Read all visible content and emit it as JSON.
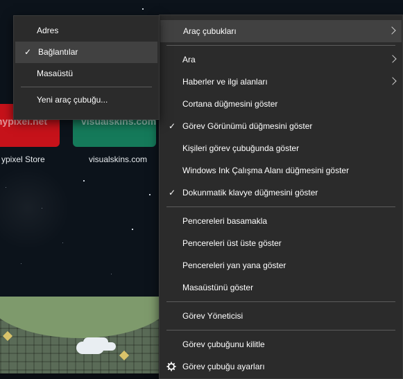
{
  "background": {
    "tiles": [
      {
        "name": "hypixel",
        "tile_text": "e.hypixel.net",
        "caption": "ypixel Store",
        "color": "#c6121a"
      },
      {
        "name": "visualskins",
        "tile_text": "visualskins.com",
        "caption": "visualskins.com",
        "color": "#157a5a"
      }
    ]
  },
  "submenu": {
    "items": [
      {
        "label": "Adres",
        "checked": false,
        "highlighted": false
      },
      {
        "label": "Bağlantılar",
        "checked": true,
        "highlighted": true
      },
      {
        "label": "Masaüstü",
        "checked": false,
        "highlighted": false
      },
      {
        "label": "Yeni araç çubuğu...",
        "checked": false,
        "highlighted": false
      }
    ]
  },
  "main_menu": {
    "groups": [
      [
        {
          "label": "Araç çubukları",
          "submenu": true,
          "highlighted": true
        }
      ],
      [
        {
          "label": "Ara",
          "submenu": true
        },
        {
          "label": "Haberler ve ilgi alanları",
          "submenu": true
        },
        {
          "label": "Cortana düğmesini göster"
        },
        {
          "label": "Görev Görünümü düğmesini göster",
          "checked": true
        },
        {
          "label": "Kişileri görev çubuğunda göster"
        },
        {
          "label": "Windows Ink Çalışma Alanı düğmesini göster"
        },
        {
          "label": "Dokunmatik klavye düğmesini göster",
          "checked": true
        }
      ],
      [
        {
          "label": "Pencereleri basamakla"
        },
        {
          "label": "Pencereleri üst üste göster"
        },
        {
          "label": "Pencereleri yan yana göster"
        },
        {
          "label": "Masaüstünü göster"
        }
      ],
      [
        {
          "label": "Görev Yöneticisi"
        }
      ],
      [
        {
          "label": "Görev çubuğunu kilitle"
        },
        {
          "label": "Görev çubuğu ayarları",
          "icon": "gear-icon"
        }
      ]
    ]
  }
}
